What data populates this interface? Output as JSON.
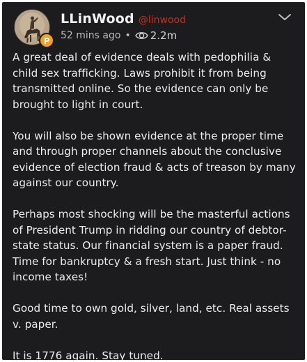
{
  "post": {
    "display_name": "LLinWood",
    "handle": "@linwood",
    "time": "52 mins ago",
    "separator": "•",
    "views": "2.2m",
    "paragraphs": [
      "A great deal of evidence deals with pedophilia & child sex trafficking. Laws prohibit it from being transmitted online. So the evidence can only be brought to light in court.",
      "You will also be shown evidence at the proper time and through proper channels about the conclusive evidence of election fraud & acts of treason by many against our country.",
      "Perhaps most shocking will be the masterful actions of President Trump in ridding our country of debtor-state status. Our financial system is a paper fraud. Time for bankruptcy & a fresh start. Just think - no income taxes!",
      "Good time to own gold, silver, land, etc. Real assets v. paper.",
      "It is 1776 again. Stay tuned."
    ]
  },
  "icons": {
    "avatar": "avatar-image",
    "badge": "parler-p-badge-icon",
    "views": "eye-icon",
    "menu": "chevron-down-icon"
  },
  "colors": {
    "background": "#1c1c1e",
    "text": "#ececec",
    "handle": "#c2321f",
    "badge": "#f1a21f",
    "meta": "#b8b8b8"
  }
}
